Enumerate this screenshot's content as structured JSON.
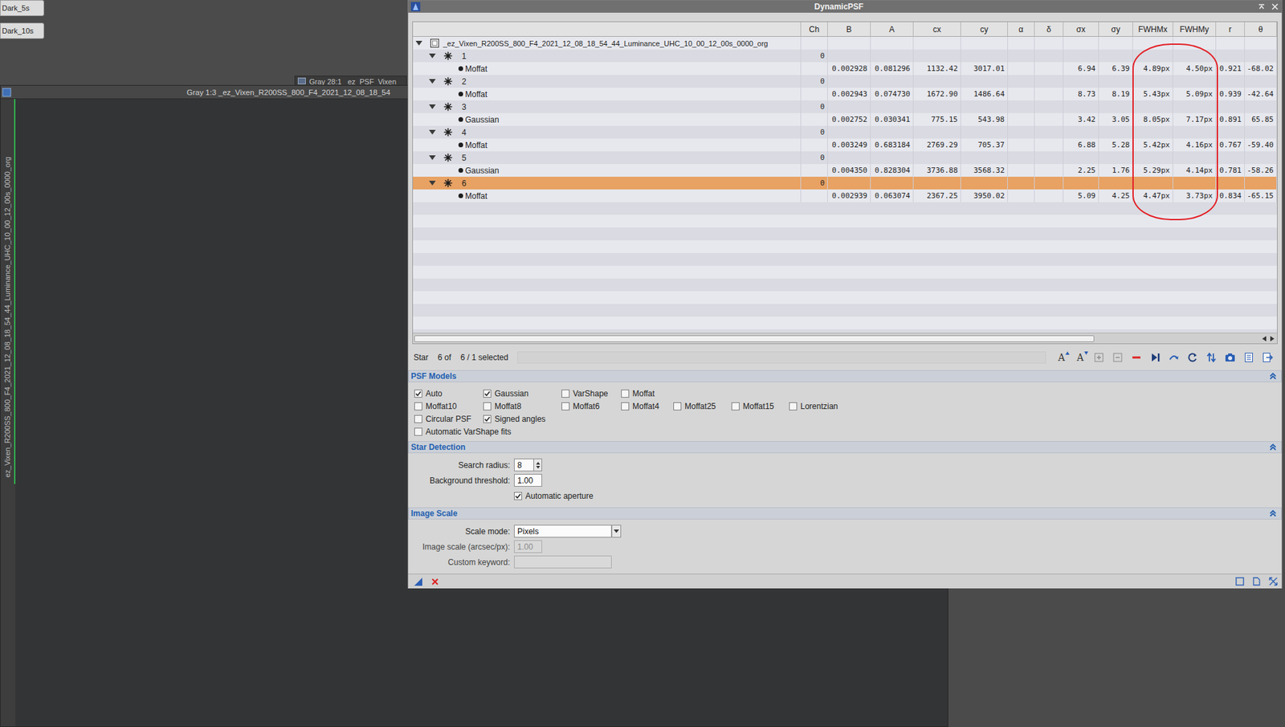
{
  "workspace_icons": [
    {
      "label": "Dark_5s"
    },
    {
      "label": "Dark_10s"
    }
  ],
  "background_window": {
    "title": "Gray 28:1 _ez_PSF_Vixen"
  },
  "image_window": {
    "title": "Gray 1:3 _ez_Vixen_R200SS_800_F4_2021_12_08_18_54",
    "side_label": "ez_Vixen_R200SS_800_F4_2021_12_08_18_54_44_Luminance_UHC_10_00_12_00s_0000_org"
  },
  "dynamic_psf": {
    "title": "DynamicPSF",
    "table": {
      "columns": [
        {
          "label": "Ch"
        },
        {
          "label": "B"
        },
        {
          "label": "A"
        },
        {
          "label": "cx"
        },
        {
          "label": "cy"
        },
        {
          "label": "α"
        },
        {
          "label": "δ"
        },
        {
          "label": "σx"
        },
        {
          "label": "σy"
        },
        {
          "label": "FWHMx"
        },
        {
          "label": "FWHMy"
        },
        {
          "label": "r"
        },
        {
          "label": "θ"
        }
      ],
      "root": {
        "label": "_ez_Vixen_R200SS_800_F4_2021_12_08_18_54_44_Luminance_UHC_10_00_12_00s_0000_org",
        "expanded": true
      },
      "stars": [
        {
          "id": "1",
          "channel": "0",
          "expanded": true,
          "selected": false,
          "fit": {
            "model": "Moffat",
            "B": "0.002928",
            "A": "0.081296",
            "cx": "1132.42",
            "cy": "3017.01",
            "sigma_x": "6.94",
            "sigma_y": "6.39",
            "fwhm_x": "4.89px",
            "fwhm_y": "4.50px",
            "r": "0.921",
            "theta": "-68.02"
          }
        },
        {
          "id": "2",
          "channel": "0",
          "expanded": true,
          "selected": false,
          "fit": {
            "model": "Moffat",
            "B": "0.002943",
            "A": "0.074730",
            "cx": "1672.90",
            "cy": "1486.64",
            "sigma_x": "8.73",
            "sigma_y": "8.19",
            "fwhm_x": "5.43px",
            "fwhm_y": "5.09px",
            "r": "0.939",
            "theta": "-42.64"
          }
        },
        {
          "id": "3",
          "channel": "0",
          "expanded": true,
          "selected": false,
          "fit": {
            "model": "Gaussian",
            "B": "0.002752",
            "A": "0.030341",
            "cx": "775.15",
            "cy": "543.98",
            "sigma_x": "3.42",
            "sigma_y": "3.05",
            "fwhm_x": "8.05px",
            "fwhm_y": "7.17px",
            "r": "0.891",
            "theta": "65.85"
          }
        },
        {
          "id": "4",
          "channel": "0",
          "expanded": true,
          "selected": false,
          "fit": {
            "model": "Moffat",
            "B": "0.003249",
            "A": "0.683184",
            "cx": "2769.29",
            "cy": "705.37",
            "sigma_x": "6.88",
            "sigma_y": "5.28",
            "fwhm_x": "5.42px",
            "fwhm_y": "4.16px",
            "r": "0.767",
            "theta": "-59.40"
          }
        },
        {
          "id": "5",
          "channel": "0",
          "expanded": true,
          "selected": false,
          "fit": {
            "model": "Gaussian",
            "B": "0.004350",
            "A": "0.828304",
            "cx": "3736.88",
            "cy": "3568.32",
            "sigma_x": "2.25",
            "sigma_y": "1.76",
            "fwhm_x": "5.29px",
            "fwhm_y": "4.14px",
            "r": "0.781",
            "theta": "-58.26"
          }
        },
        {
          "id": "6",
          "channel": "0",
          "expanded": true,
          "selected": true,
          "fit": {
            "model": "Moffat",
            "B": "0.002939",
            "A": "0.063074",
            "cx": "2367.25",
            "cy": "3950.02",
            "sigma_x": "5.09",
            "sigma_y": "4.25",
            "fwhm_x": "4.47px",
            "fwhm_y": "3.73px",
            "r": "0.834",
            "theta": "-65.15"
          }
        }
      ]
    },
    "status": {
      "label": "Star",
      "position": "6 of",
      "selection": "6 / 1 selected"
    },
    "toolbar": [
      {
        "kind": "font-up",
        "label": "A"
      },
      {
        "kind": "font-down",
        "label": "A"
      },
      {
        "kind": "expand"
      },
      {
        "kind": "collapse"
      },
      {
        "kind": "delete"
      },
      {
        "kind": "next"
      },
      {
        "kind": "redo"
      },
      {
        "kind": "reset"
      },
      {
        "kind": "sort"
      },
      {
        "kind": "camera"
      },
      {
        "kind": "calc"
      },
      {
        "kind": "export"
      }
    ],
    "psf_models": {
      "title": "PSF Models",
      "expanded": true,
      "options": [
        [
          {
            "label": "Auto",
            "checked": true
          },
          {
            "label": "Gaussian",
            "checked": true
          },
          {
            "label": "VarShape",
            "checked": false
          },
          {
            "label": "Moffat",
            "checked": false
          }
        ],
        [
          {
            "label": "Moffat10",
            "checked": false
          },
          {
            "label": "Moffat8",
            "checked": false
          },
          {
            "label": "Moffat6",
            "checked": false
          },
          {
            "label": "Moffat4",
            "checked": false
          },
          {
            "label": "Moffat25",
            "checked": false
          },
          {
            "label": "Moffat15",
            "checked": false
          },
          {
            "label": "Lorentzian",
            "checked": false
          }
        ],
        [
          {
            "label": "Circular PSF",
            "checked": false
          },
          {
            "label": "Signed angles",
            "checked": true
          }
        ],
        [
          {
            "label": "Automatic VarShape fits",
            "checked": false
          }
        ]
      ]
    },
    "star_detection": {
      "title": "Star Detection",
      "expanded": true,
      "fields": [
        {
          "label": "Search radius:",
          "value": "8",
          "kind": "spin",
          "disabled": false
        },
        {
          "label": "Background threshold:",
          "value": "1.00",
          "kind": "text",
          "disabled": false
        },
        {
          "label": "Automatic aperture",
          "checked": true,
          "kind": "checkbox",
          "disabled": false
        }
      ]
    },
    "image_scale": {
      "title": "Image Scale",
      "expanded": true,
      "fields": [
        {
          "label": "Scale mode:",
          "value": "Pixels",
          "kind": "select",
          "disabled": false
        },
        {
          "label": "Image scale (arcsec/px):",
          "value": "1.00",
          "kind": "text",
          "disabled": true
        },
        {
          "label": "Custom keyword:",
          "value": "",
          "kind": "text",
          "disabled": true
        }
      ]
    }
  }
}
